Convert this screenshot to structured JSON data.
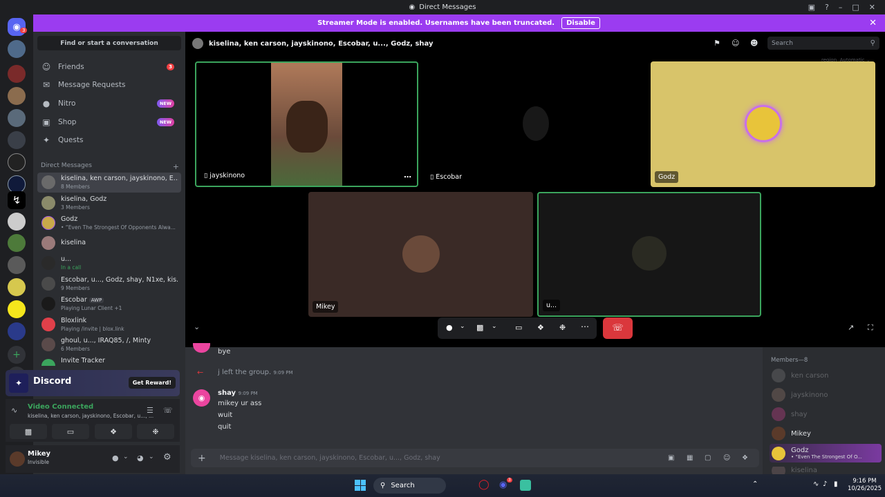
{
  "window": {
    "title": "Direct Messages"
  },
  "banner": {
    "text": "Streamer Mode is enabled. Usernames have been truncated.",
    "button": "Disable"
  },
  "guilds": {
    "notification_count": "3"
  },
  "sidebar": {
    "search_placeholder": "Find or start a conversation",
    "nav": [
      {
        "label": "Friends",
        "badge": "3"
      },
      {
        "label": "Message Requests"
      },
      {
        "label": "Nitro",
        "badge": "NEW"
      },
      {
        "label": "Shop",
        "badge": "NEW"
      },
      {
        "label": "Quests"
      }
    ],
    "dm_header": "Direct Messages",
    "dms": [
      {
        "name": "kiselina, ken carson, jayskinono, E...",
        "sub": "8 Members"
      },
      {
        "name": "kiselina, Godz",
        "sub": "3 Members"
      },
      {
        "name": "Godz",
        "sub": "• “Even The Strongest Of Opponents Alwa..."
      },
      {
        "name": "kiselina",
        "sub": ""
      },
      {
        "name": "u...",
        "sub": "In a call"
      },
      {
        "name": "Escobar, u..., Godz, shay, N1xe, kis...",
        "sub": "9 Members"
      },
      {
        "name": "Escobar",
        "tag": "AWP",
        "sub": "Playing Lunar Client +1"
      },
      {
        "name": "Bloxlink",
        "sub": "Playing /invite | blox.link"
      },
      {
        "name": "ghoul, u..., IRAQ85, /, Minty",
        "sub": "6 Members"
      },
      {
        "name": "Invite Tracker",
        "sub": ""
      }
    ],
    "promo": {
      "brand": "Discord",
      "button": "Get Reward!"
    },
    "voice": {
      "status": "Video Connected",
      "channel": "kiselina, ken carson, jayskinono, Escobar, u..., ..."
    },
    "user": {
      "name": "Mikey",
      "status": "Invisible"
    }
  },
  "call": {
    "title": "kiselina, ken carson, jayskinono, Escobar, u..., Godz, shay",
    "search_placeholder": "Search",
    "region_label": "region",
    "region_value": "Automatic",
    "tiles": [
      {
        "name": "jayskinono"
      },
      {
        "name": "Escobar"
      },
      {
        "name": "Godz"
      },
      {
        "name": "Mikey"
      },
      {
        "name": "u..."
      }
    ]
  },
  "chat": {
    "messages": [
      {
        "text": "bye"
      },
      {
        "system": "j left the group.",
        "time": "9:09 PM"
      },
      {
        "author": "shay",
        "time": "9:09 PM",
        "lines": [
          "mikey ur ass",
          "wuit",
          "quit"
        ]
      }
    ],
    "composer_placeholder": "Message kiselina, ken carson, jayskinono, Escobar, u..., Godz, shay"
  },
  "members": {
    "header": "Members—8",
    "list": [
      {
        "name": "ken carson",
        "dim": true
      },
      {
        "name": "jayskinono",
        "dim": true
      },
      {
        "name": "shay",
        "dim": true
      },
      {
        "name": "Mikey",
        "dim": false
      },
      {
        "name": "Godz",
        "sub": "• “Even The Strongest Of O...",
        "dim": false
      },
      {
        "name": "kiselina",
        "dim": true
      }
    ]
  },
  "taskbar": {
    "search": "Search",
    "time": "9:16 PM",
    "date": "10/26/2025",
    "discord_badge": "3"
  },
  "colors": {
    "banner": "#9b3cf0",
    "hangup": "#da373c",
    "speaking": "#3ba55d",
    "godz_tile": "#d8c46a",
    "mikey_tile": "#3a2a26"
  }
}
